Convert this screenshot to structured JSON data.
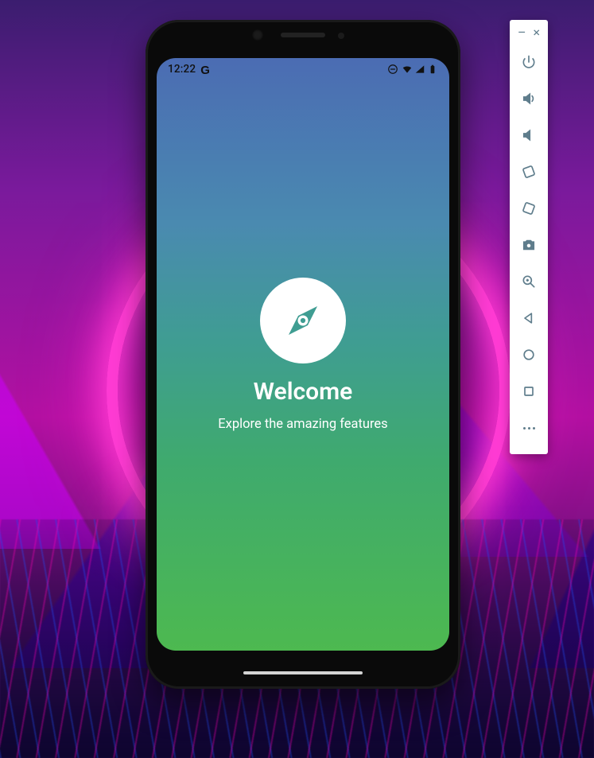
{
  "status_bar": {
    "time": "12:22",
    "google_label": "G"
  },
  "splash": {
    "title": "Welcome",
    "subtitle": "Explore the amazing features"
  },
  "emulator_toolbar": {
    "minimize": "–",
    "close": "×"
  }
}
